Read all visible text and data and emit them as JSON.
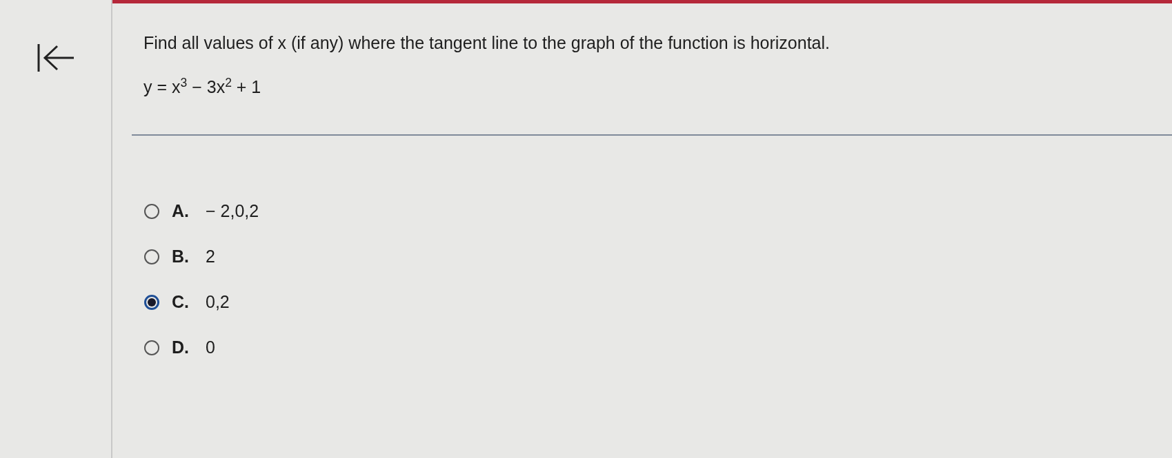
{
  "question": {
    "prompt": "Find all values of x (if any) where the tangent line to the graph of the function is horizontal.",
    "equation": "y = x$^{3}$ − 3x$^{2}$ + 1"
  },
  "options": [
    {
      "letter": "A.",
      "value": "− 2,0,2",
      "selected": false
    },
    {
      "letter": "B.",
      "value": "2",
      "selected": false
    },
    {
      "letter": "C.",
      "value": "0,2",
      "selected": true
    },
    {
      "letter": "D.",
      "value": "0",
      "selected": false
    }
  ]
}
